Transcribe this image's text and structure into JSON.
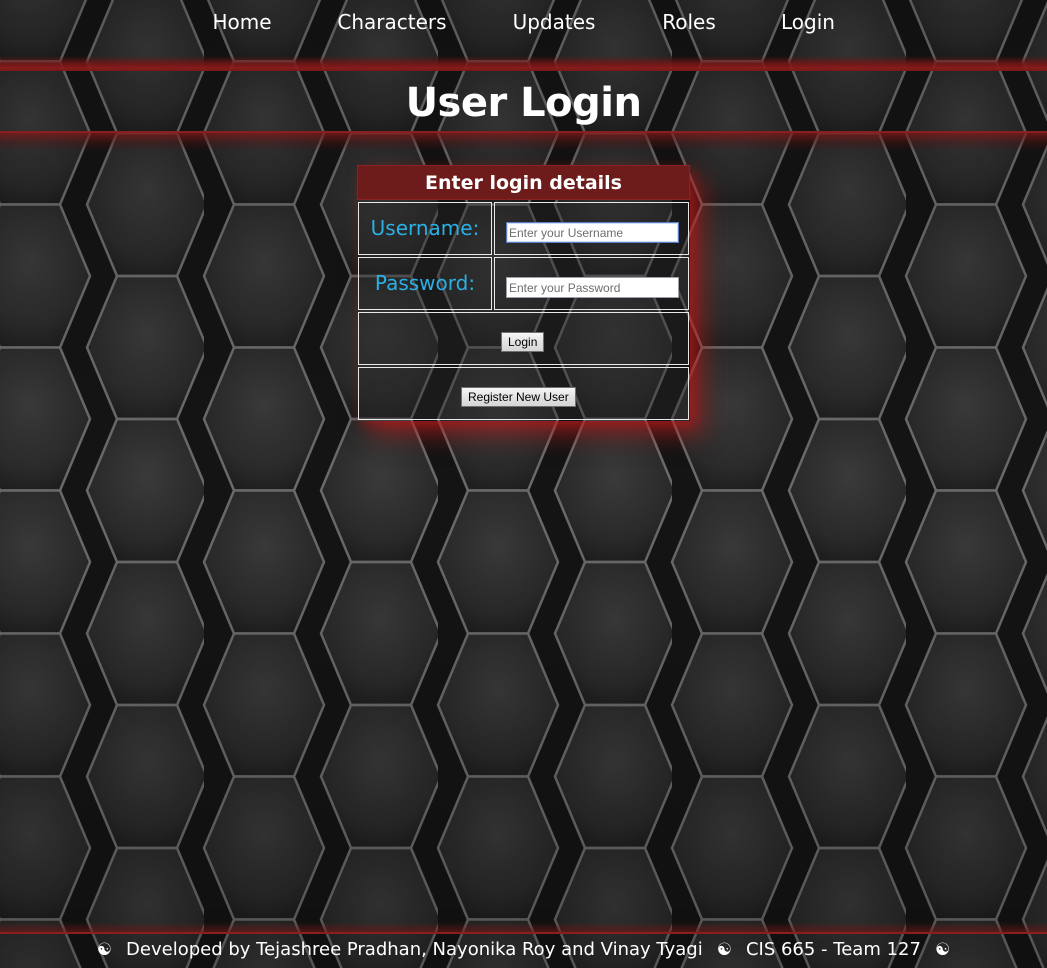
{
  "nav": {
    "items": [
      {
        "label": "Home"
      },
      {
        "label": "Characters"
      },
      {
        "label": "Updates"
      },
      {
        "label": "Roles"
      },
      {
        "label": "Login"
      }
    ]
  },
  "page": {
    "title": "User Login"
  },
  "login_form": {
    "header": "Enter login details",
    "username_label": "Username:",
    "username_placeholder": "Enter your Username",
    "username_value": "",
    "password_label": "Password:",
    "password_placeholder": "Enter your Password",
    "password_value": "",
    "login_button": "Login",
    "register_button": "Register New User"
  },
  "footer": {
    "separator_icon": "yin-yang-icon",
    "separator_glyph": "☯",
    "credits": "Developed by Tejashree Pradhan, Nayonika Roy and Vinay Tyagi",
    "course": "CIS 665 - Team 127"
  },
  "colors": {
    "accent_red": "#6d1b1b",
    "label_blue": "#2ab0e6",
    "background": "#2b2b2b"
  }
}
